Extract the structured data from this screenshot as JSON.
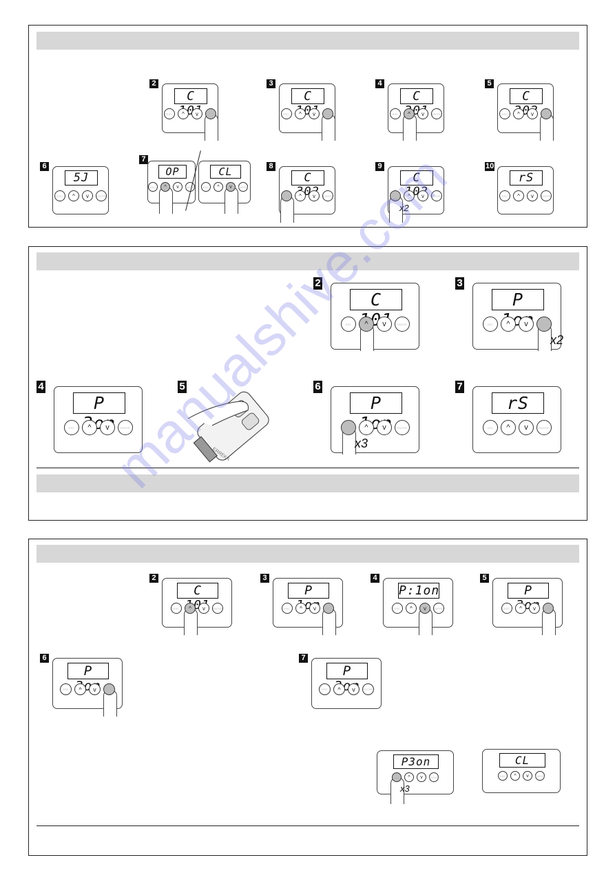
{
  "button_labels": {
    "esc": "ESC",
    "up": "^",
    "down": "v",
    "enter": "ENTER"
  },
  "watermark": "manualshive.com",
  "sections": [
    {
      "id": "section-1",
      "steps": [
        {
          "num": "2",
          "display": "C 101",
          "pressed": "enter",
          "multiplier": ""
        },
        {
          "num": "3",
          "display": "C 101",
          "pressed": "enter",
          "multiplier": ""
        },
        {
          "num": "4",
          "display": "C 301",
          "pressed": "up",
          "multiplier": ""
        },
        {
          "num": "5",
          "display": "C 302",
          "pressed": "enter",
          "multiplier": ""
        },
        {
          "num": "6",
          "display": "  5J  ",
          "pressed": "",
          "multiplier": ""
        },
        {
          "num": "7",
          "display": "OP",
          "display_b": "CL",
          "pressed": "up",
          "pressed_b": "down",
          "multiplier": ""
        },
        {
          "num": "8",
          "display": "C 302",
          "pressed": "esc",
          "multiplier": ""
        },
        {
          "num": "9",
          "display": "C 102",
          "pressed": "esc",
          "multiplier": "x2"
        },
        {
          "num": "10",
          "display": "rS",
          "pressed": "",
          "multiplier": ""
        }
      ]
    },
    {
      "id": "section-2",
      "steps": [
        {
          "num": "2",
          "display": "C 101",
          "pressed": "up",
          "multiplier": ""
        },
        {
          "num": "3",
          "display": "P 1on",
          "pressed": "enter",
          "multiplier": "x2"
        },
        {
          "num": "4",
          "display": "P 3on",
          "pressed": "",
          "multiplier": ""
        },
        {
          "num": "5",
          "display": "",
          "remote_brand": "ERREKA",
          "pressed": "",
          "multiplier": ""
        },
        {
          "num": "6",
          "display": "P 1on",
          "pressed": "esc",
          "multiplier": "x3"
        },
        {
          "num": "7",
          "display": "rS",
          "pressed": "",
          "multiplier": ""
        }
      ]
    },
    {
      "id": "section-3",
      "steps": [
        {
          "num": "2",
          "display": "C 101",
          "pressed": "up",
          "multiplier": ""
        },
        {
          "num": "3",
          "display": "P 1on",
          "pressed": "enter",
          "multiplier": ""
        },
        {
          "num": "4",
          "display": "P:1on",
          "pressed": "down",
          "multiplier": ""
        },
        {
          "num": "5",
          "display": "P 3on",
          "pressed": "enter",
          "multiplier": ""
        },
        {
          "num": "6",
          "display": "P 3on",
          "pressed": "enter",
          "multiplier": ""
        },
        {
          "num": "7",
          "display": "P 3on",
          "pressed": "",
          "multiplier": ""
        },
        {
          "num": "",
          "display": "P3on",
          "pressed": "esc",
          "multiplier": "x3"
        },
        {
          "num": "",
          "display": "CL",
          "pressed": "",
          "multiplier": ""
        }
      ]
    }
  ]
}
